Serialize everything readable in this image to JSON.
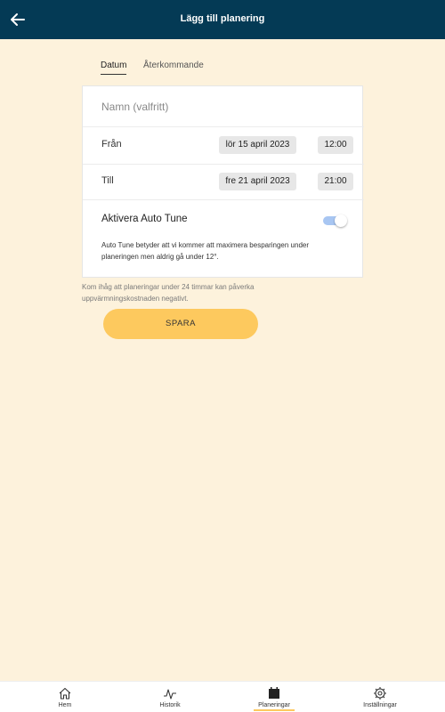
{
  "header": {
    "title": "Lägg till planering",
    "back_icon": "arrow-left-icon"
  },
  "tabs": [
    {
      "label": "Datum",
      "active": true
    },
    {
      "label": "Återkommande",
      "active": false
    }
  ],
  "form": {
    "name_placeholder": "Namn (valfritt)",
    "from": {
      "label": "Från",
      "date": "lör 15 april 2023",
      "time": "12:00"
    },
    "to": {
      "label": "Till",
      "date": "fre 21 april 2023",
      "time": "21:00"
    },
    "autotune": {
      "label": "Aktivera Auto Tune",
      "enabled": true,
      "description": "Auto Tune betyder att vi kommer att maximera besparingen under planeringen men aldrig gå under 12°."
    }
  },
  "note": "Kom ihåg att planeringar under 24 timmar kan påverka uppvärmningskostnaden negativt.",
  "save_label": "SPARA",
  "colors": {
    "appbar": "#043a55",
    "background": "#fdf2dc",
    "accent": "#fdc95e",
    "toggle": "#a8c6f2"
  },
  "bottom_nav": [
    {
      "label": "Hem",
      "icon": "home-icon",
      "active": false
    },
    {
      "label": "Historik",
      "icon": "history-icon",
      "active": false
    },
    {
      "label": "Planeringar",
      "icon": "calendar-icon",
      "active": true
    },
    {
      "label": "Inställningar",
      "icon": "gear-icon",
      "active": false
    }
  ]
}
